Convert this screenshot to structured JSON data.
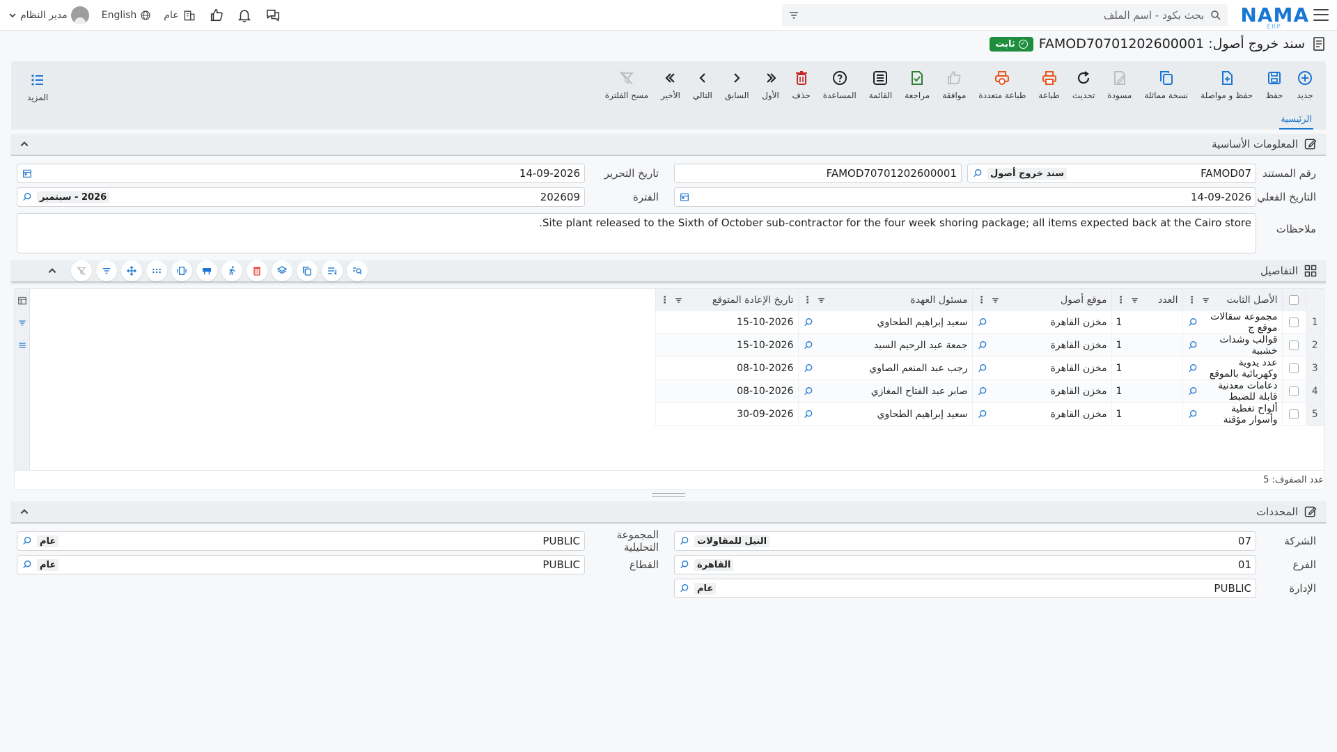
{
  "topbar": {
    "logo": "NAMA",
    "logo_sub": "ERP",
    "search_placeholder": "بحث بكود - اسم الملف",
    "user": "مدير النظام",
    "language": "English",
    "scope": "عام"
  },
  "document": {
    "title": "سند خروج أصول: FAMOD70701202600001",
    "status": "ثابت"
  },
  "toolbar": {
    "buttons": [
      {
        "label": "جديد",
        "icon": "plus-circle-icon",
        "color": "#1976d2"
      },
      {
        "label": "حفظ",
        "icon": "save-icon",
        "color": "#1976d2"
      },
      {
        "label": "حفظ و مواصلة",
        "icon": "save-continue-icon",
        "color": "#1976d2"
      },
      {
        "label": "نسخة مماثلة",
        "icon": "copy-icon",
        "color": "#1976d2"
      },
      {
        "label": "مسودة",
        "icon": "draft-icon",
        "color": "#bdbdbd"
      },
      {
        "label": "تحديث",
        "icon": "refresh-icon",
        "color": "#222"
      },
      {
        "label": "طباعة",
        "icon": "print-icon",
        "color": "#e8561f"
      },
      {
        "label": "طباعة متعددة",
        "icon": "multi-print-icon",
        "color": "#e8561f"
      },
      {
        "label": "موافقة",
        "icon": "thumbs-up-icon",
        "color": "#bdbdbd"
      },
      {
        "label": "مراجعة",
        "icon": "review-icon",
        "color": "#2e7d32"
      },
      {
        "label": "القائمة",
        "icon": "list-icon",
        "color": "#222"
      },
      {
        "label": "المساعدة",
        "icon": "help-icon",
        "color": "#222"
      },
      {
        "label": "حذف",
        "icon": "trash-icon",
        "color": "#c62828"
      },
      {
        "label": "الأول",
        "icon": "first-icon",
        "color": "#222"
      },
      {
        "label": "السابق",
        "icon": "prev-icon",
        "color": "#222"
      },
      {
        "label": "التالي",
        "icon": "next-icon",
        "color": "#222"
      },
      {
        "label": "الأخير",
        "icon": "last-icon",
        "color": "#222"
      },
      {
        "label": "مسح الفلترة",
        "icon": "clear-filter-icon",
        "color": "#bdbdbd"
      }
    ],
    "more": "المزيد"
  },
  "tabs": {
    "main": "الرئيسية"
  },
  "basic": {
    "title": "المعلومات الأساسية",
    "doc_number_label": "رقم المستند",
    "doc_code": "FAMOD07",
    "doc_type": "سند خروج أصول",
    "doc_full": "FAMOD70701202600001",
    "edit_date_label": "تاريخ التحرير",
    "edit_date": "14-09-2026",
    "actual_date_label": "التاريخ الفعلي",
    "actual_date": "14-09-2026",
    "period_label": "الفترة",
    "period_code": "202609",
    "period_name": "2026 - سبتمبر",
    "notes_label": "ملاحظات",
    "notes": "Site plant released to the Sixth of October sub-contractor for the four week shoring package; all items expected back at the Cairo store."
  },
  "details": {
    "title": "التفاصيل",
    "columns": [
      "الأصل الثابت",
      "العدد",
      "موقع أصول",
      "مسئول العهدة",
      "تاريخ الإعادة المتوقع"
    ],
    "rows": [
      {
        "n": "1",
        "asset": "مجموعة سقالات موقع ج",
        "qty": "1",
        "loc": "مخزن القاهرة",
        "owner": "سعيد إبراهيم الطحاوي",
        "ret": "15-10-2026"
      },
      {
        "n": "2",
        "asset": "قوالب وشدات خشبية",
        "qty": "1",
        "loc": "مخزن القاهرة",
        "owner": "جمعة عبد الرحيم السيد",
        "ret": "15-10-2026"
      },
      {
        "n": "3",
        "asset": "عدد يدوية وكهربائية بالموقع",
        "qty": "1",
        "loc": "مخزن القاهرة",
        "owner": "رجب عبد المنعم الصاوي",
        "ret": "08-10-2026"
      },
      {
        "n": "4",
        "asset": "دعامات معدنية قابلة للضبط",
        "qty": "1",
        "loc": "مخزن القاهرة",
        "owner": "صابر عبد الفتاح المغازي",
        "ret": "08-10-2026"
      },
      {
        "n": "5",
        "asset": "ألواح تغطية وأسوار مؤقتة",
        "qty": "1",
        "loc": "مخزن القاهرة",
        "owner": "سعيد إبراهيم الطحاوي",
        "ret": "30-09-2026"
      }
    ],
    "row_count": "عدد الصفوف: 5"
  },
  "dimensions": {
    "title": "المحددات",
    "company_label": "الشركة",
    "company_code": "07",
    "company_name": "النيل للمقاولات",
    "analytic_label": "المجموعة التحليلية",
    "analytic_code": "PUBLIC",
    "analytic_name": "عام",
    "branch_label": "الفرع",
    "branch_code": "01",
    "branch_name": "القاهرة",
    "sector_label": "القطاع",
    "sector_code": "PUBLIC",
    "sector_name": "عام",
    "dept_label": "الإدارة",
    "dept_code": "PUBLIC",
    "dept_name": "عام"
  }
}
